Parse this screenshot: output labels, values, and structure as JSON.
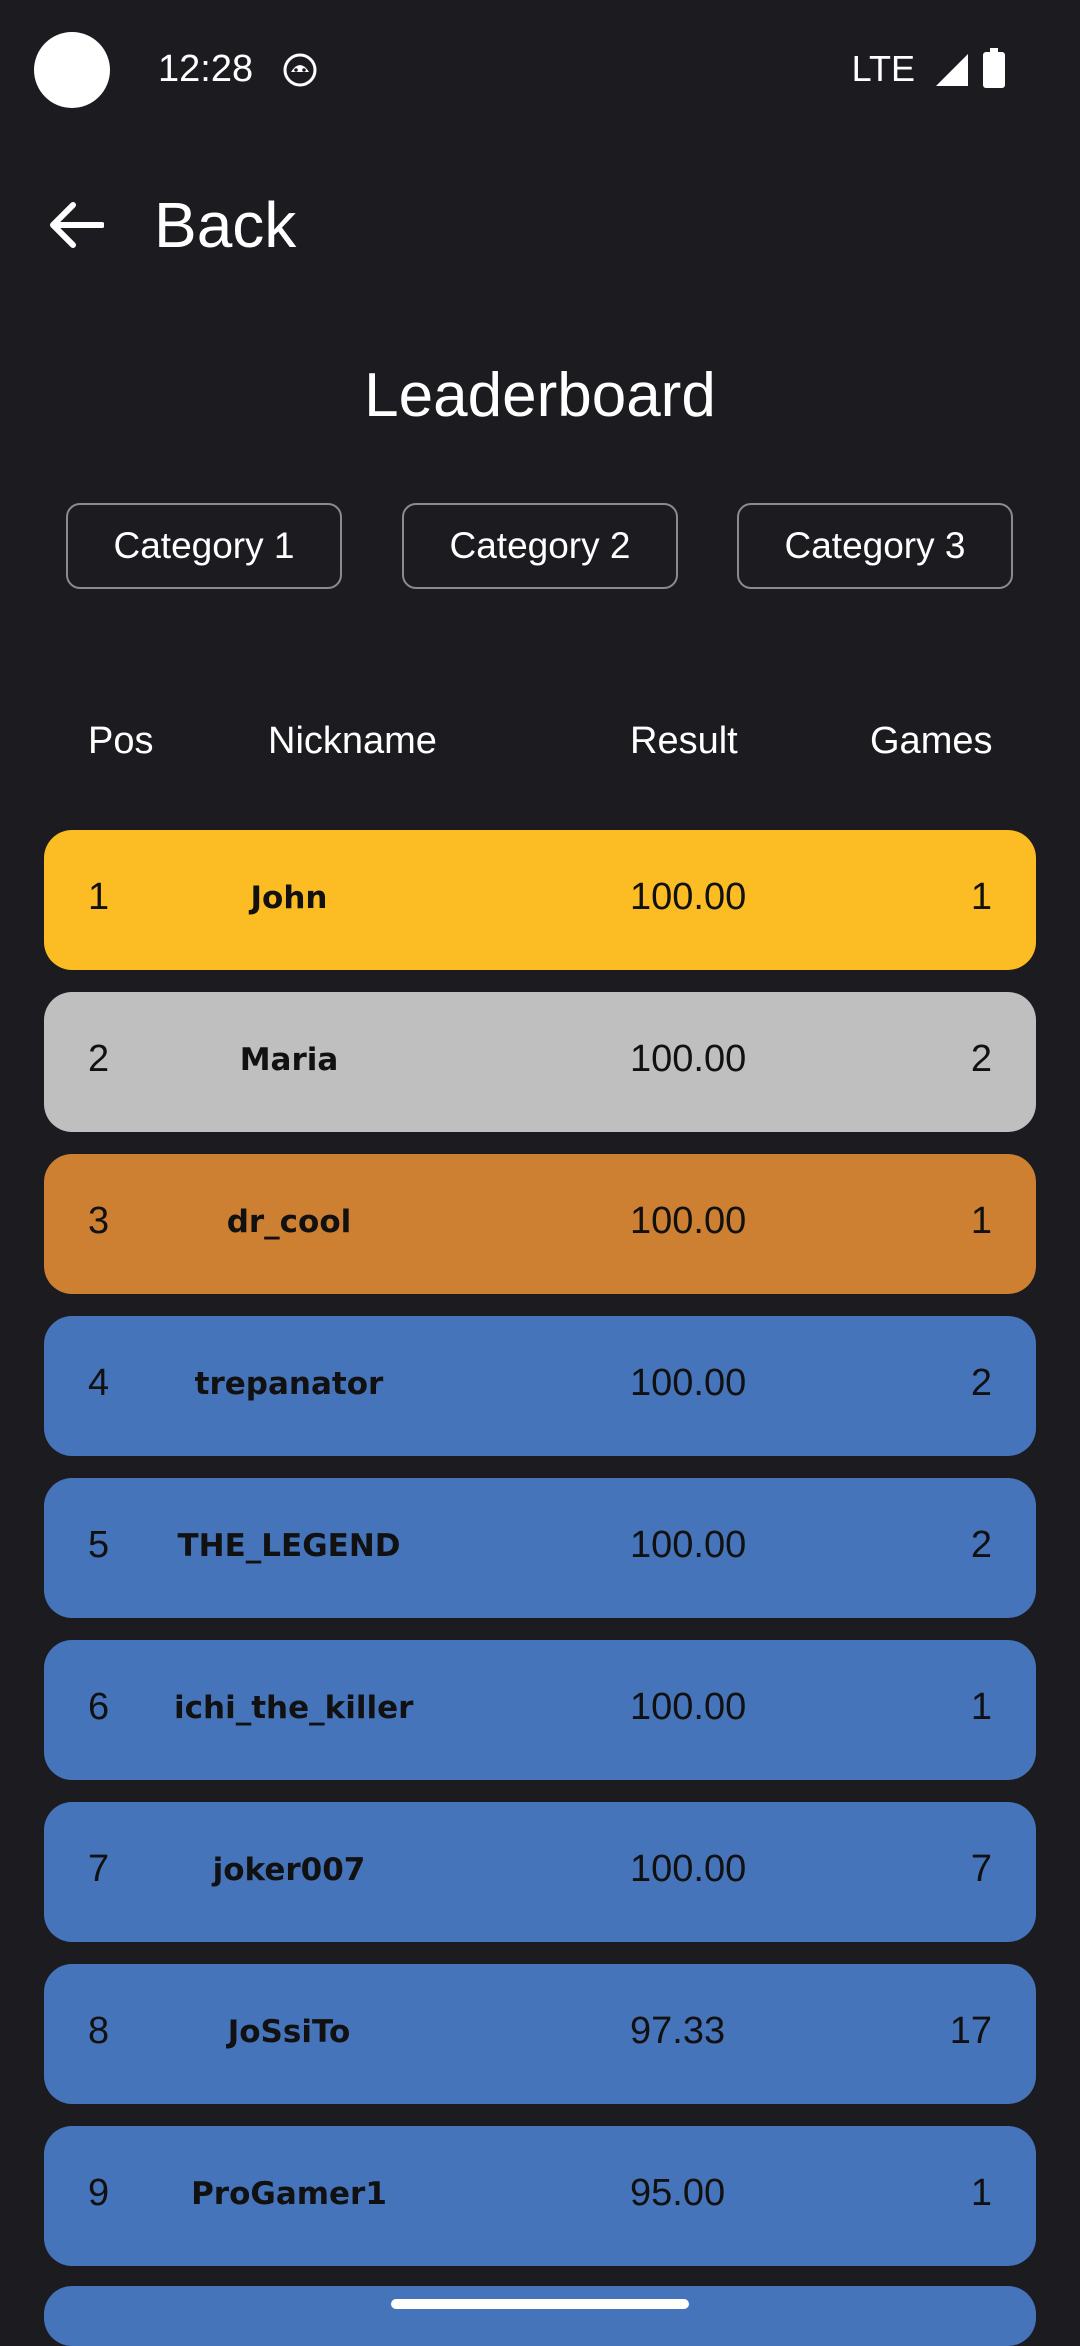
{
  "status_bar": {
    "time": "12:28",
    "network": "LTE"
  },
  "top_bar": {
    "back_label": "Back"
  },
  "page": {
    "title": "Leaderboard"
  },
  "categories": [
    "Category 1",
    "Category 2",
    "Category 3"
  ],
  "table": {
    "headers": {
      "pos": "Pos",
      "nickname": "Nickname",
      "result": "Result",
      "games": "Games"
    },
    "rows": [
      {
        "pos": "1",
        "nickname": "John",
        "result": "100.00",
        "games": "1",
        "color": "#fbbc24"
      },
      {
        "pos": "2",
        "nickname": "Maria",
        "result": "100.00",
        "games": "2",
        "color": "#bfbfbf"
      },
      {
        "pos": "3",
        "nickname": "dr_cool",
        "result": "100.00",
        "games": "1",
        "color": "#cd7f32"
      },
      {
        "pos": "4",
        "nickname": "trepanator",
        "result": "100.00",
        "games": "2",
        "color": "#4674bb"
      },
      {
        "pos": "5",
        "nickname": "THE_LEGEND",
        "result": "100.00",
        "games": "2",
        "color": "#4674bb"
      },
      {
        "pos": "6",
        "nickname": "ichi_the_killer",
        "result": "100.00",
        "games": "1",
        "color": "#4674bb"
      },
      {
        "pos": "7",
        "nickname": "joker007",
        "result": "100.00",
        "games": "7",
        "color": "#4674bb"
      },
      {
        "pos": "8",
        "nickname": "JoSsiTo",
        "result": "97.33",
        "games": "17",
        "color": "#4674bb"
      },
      {
        "pos": "9",
        "nickname": "ProGamer1",
        "result": "95.00",
        "games": "1",
        "color": "#4674bb"
      }
    ]
  },
  "colors": {
    "background": "#1c1b1f",
    "gold": "#fbbc24",
    "silver": "#bfbfbf",
    "bronze": "#cd7f32",
    "default_row": "#4674bb"
  },
  "icons": {
    "back": "arrow-back-icon",
    "notification": "android-notification-icon",
    "signal": "cell-signal-icon",
    "battery": "battery-icon"
  }
}
